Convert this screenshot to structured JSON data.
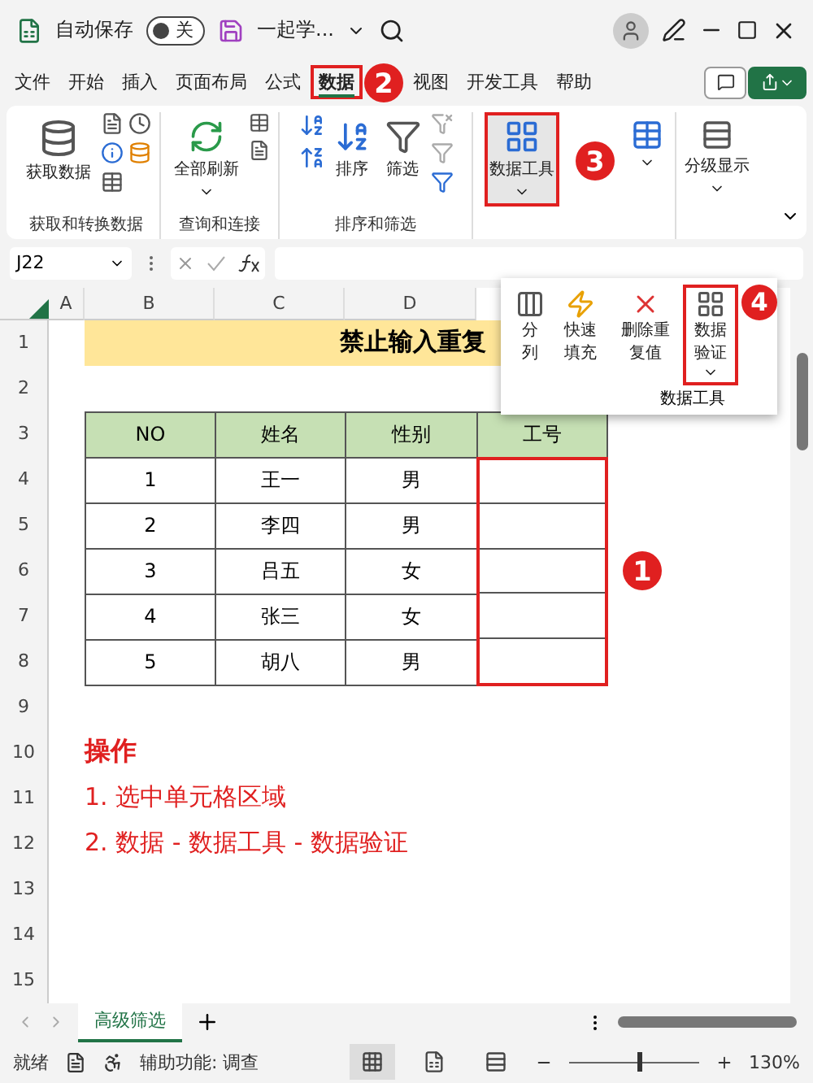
{
  "title_bar": {
    "autosave_label": "自动保存",
    "autosave": {
      "on": false,
      "label": "关"
    },
    "document_title": "一起学..."
  },
  "menu_tabs": [
    {
      "label": "文件",
      "selected": false,
      "annotated": false
    },
    {
      "label": "开始",
      "selected": false,
      "annotated": false
    },
    {
      "label": "插入",
      "selected": false,
      "annotated": false
    },
    {
      "label": "页面布局",
      "selected": false,
      "annotated": false
    },
    {
      "label": "公式",
      "selected": false,
      "annotated": false
    },
    {
      "label": "数据",
      "selected": true,
      "annotated": true
    },
    {
      "label": "视图",
      "selected": false,
      "annotated": false
    },
    {
      "label": "开发工具",
      "selected": false,
      "annotated": false
    },
    {
      "label": "帮助",
      "selected": false,
      "annotated": false
    }
  ],
  "ribbon": {
    "get_data": "获取数据",
    "get_group": "获取和转换数据",
    "refresh_all": "全部刷新",
    "query_group": "查询和连接",
    "sort": "排序",
    "filter": "筛选",
    "sort_group": "排序和筛选",
    "data_tools": {
      "label": "数据工具",
      "pressed": true,
      "annotated": true
    },
    "outline": "分级显示"
  },
  "formula_bar": {
    "name_box": "J22"
  },
  "column_headers": [
    "A",
    "B",
    "C",
    "D"
  ],
  "row_numbers": [
    "1",
    "2",
    "3",
    "4",
    "5",
    "6",
    "7",
    "8",
    "9",
    "10",
    "11",
    "12",
    "13",
    "14",
    "15"
  ],
  "sheet_title": "禁止输入重复",
  "table": {
    "columns": [
      "NO",
      "姓名",
      "性别",
      "工号"
    ],
    "last_column_annotated": true,
    "rows": [
      {
        "no": "1",
        "name": "王一",
        "gender": "男"
      },
      {
        "no": "2",
        "name": "李四",
        "gender": "男"
      },
      {
        "no": "3",
        "name": "吕五",
        "gender": "女"
      },
      {
        "no": "4",
        "name": "张三",
        "gender": "女"
      },
      {
        "no": "5",
        "name": "胡八",
        "gender": "男"
      }
    ]
  },
  "notes": {
    "heading": "操作",
    "steps": [
      "1. 选中单元格区域",
      "2. 数据 - 数据工具 - 数据验证"
    ]
  },
  "dropdown": {
    "items": [
      {
        "kind": "split",
        "label": "分列",
        "annotated": false
      },
      {
        "kind": "flash",
        "label": "快速填充",
        "annotated": false
      },
      {
        "kind": "dedupe",
        "label": "删除重复值",
        "annotated": false
      },
      {
        "kind": "validate",
        "label": "数据验证",
        "annotated": true
      }
    ],
    "group_label": "数据工具"
  },
  "annotations": [
    "1",
    "2",
    "3",
    "4"
  ],
  "sheet_tabs": [
    {
      "label": "高级筛选",
      "selected": true
    }
  ],
  "status_bar": {
    "status": "就绪",
    "accessibility": "辅助功能: 调查",
    "views": [
      {
        "kind": "normal",
        "selected": true
      },
      {
        "kind": "layout",
        "selected": false
      },
      {
        "kind": "pagebreak",
        "selected": false
      }
    ],
    "zoom": {
      "level": 0.55,
      "reading": "130%"
    }
  }
}
